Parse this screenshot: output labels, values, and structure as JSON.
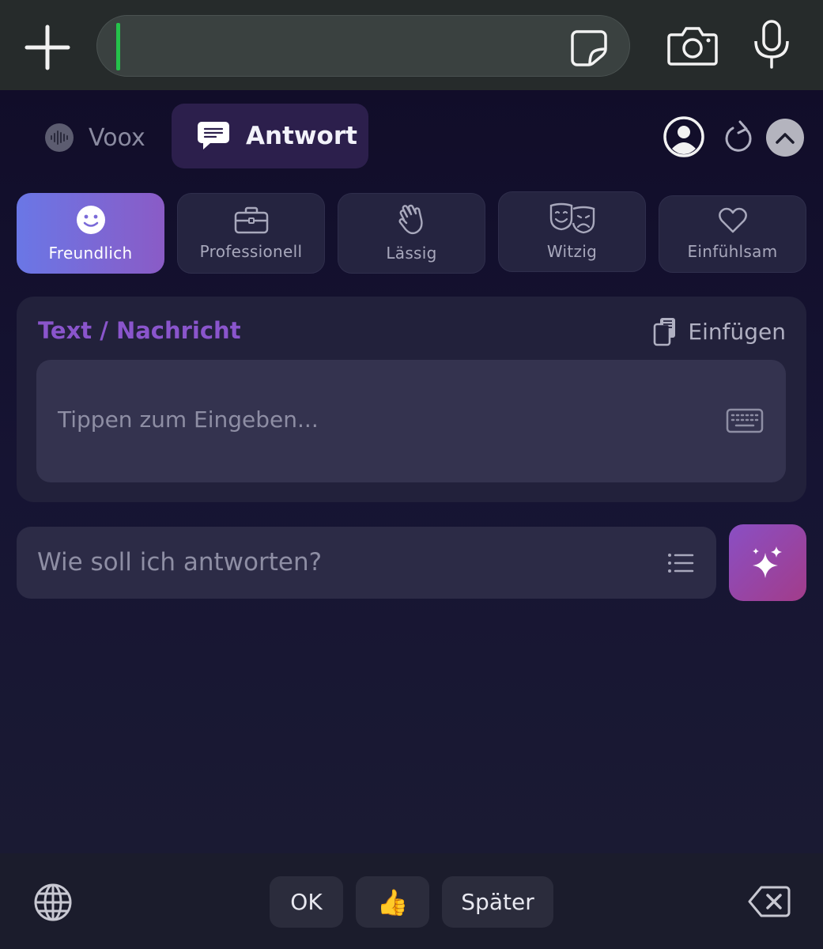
{
  "colors": {
    "accent_purple": "#8a55cc",
    "cursor_green": "#25c24b",
    "active_tone_start": "#6a77e6",
    "active_tone_end": "#8a5bc6",
    "generate_start": "#8a4fc4",
    "generate_end": "#a23c8a"
  },
  "top_bar": {
    "icons": [
      "plus-icon",
      "sticker-icon",
      "camera-icon",
      "microphone-icon"
    ],
    "input_value": ""
  },
  "header": {
    "tabs": [
      {
        "label": "Voox",
        "icon": "waveform-icon",
        "active": false
      },
      {
        "label": "Antwort",
        "icon": "chat-bubble-icon",
        "active": true
      }
    ],
    "actions": [
      "user-circle-icon",
      "refresh-icon",
      "chevron-up-icon"
    ]
  },
  "tones": [
    {
      "label": "Freundlich",
      "icon": "smiley-icon",
      "active": true
    },
    {
      "label": "Professionell",
      "icon": "briefcase-icon",
      "active": false
    },
    {
      "label": "Lässig",
      "icon": "waving-hand-icon",
      "active": false
    },
    {
      "label": "Witzig",
      "icon": "theater-masks-icon",
      "active": false
    },
    {
      "label": "Einfühlsam",
      "icon": "heart-icon",
      "active": false
    }
  ],
  "text_card": {
    "title": "Text / Nachricht",
    "paste_label": "Einfügen",
    "input_placeholder": "Tippen zum Eingeben..."
  },
  "prompt": {
    "placeholder": "Wie soll ich antworten?",
    "generate_icon": "sparkles-icon"
  },
  "quick_replies": [
    "OK",
    "👍",
    "Später"
  ],
  "bottom_bar": {
    "icons": [
      "globe-icon",
      "backspace-icon"
    ]
  }
}
